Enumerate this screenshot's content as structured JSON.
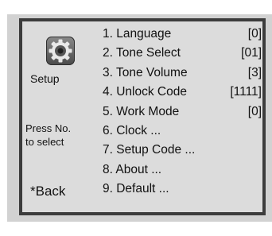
{
  "sidebar": {
    "icon": "gear-icon",
    "title": "Setup",
    "hint": "Press No.\nto select",
    "back_label": "*Back"
  },
  "menu": {
    "items": [
      {
        "label": "1. Language",
        "value": "[0]"
      },
      {
        "label": "2. Tone Select",
        "value": "[01]"
      },
      {
        "label": "3. Tone Volume",
        "value": "[3]"
      },
      {
        "label": "4. Unlock Code",
        "value": "[1111]"
      },
      {
        "label": "5. Work Mode",
        "value": "[0]"
      },
      {
        "label": "6. Clock ...",
        "value": ""
      },
      {
        "label": "7. Setup Code ...",
        "value": ""
      },
      {
        "label": "8. About ...",
        "value": ""
      },
      {
        "label": "9. Default ...",
        "value": ""
      }
    ]
  },
  "colors": {
    "panel_background": "#dcdcdc",
    "panel_border": "#3c3c3c",
    "screen_background": "#d2d2d2"
  }
}
